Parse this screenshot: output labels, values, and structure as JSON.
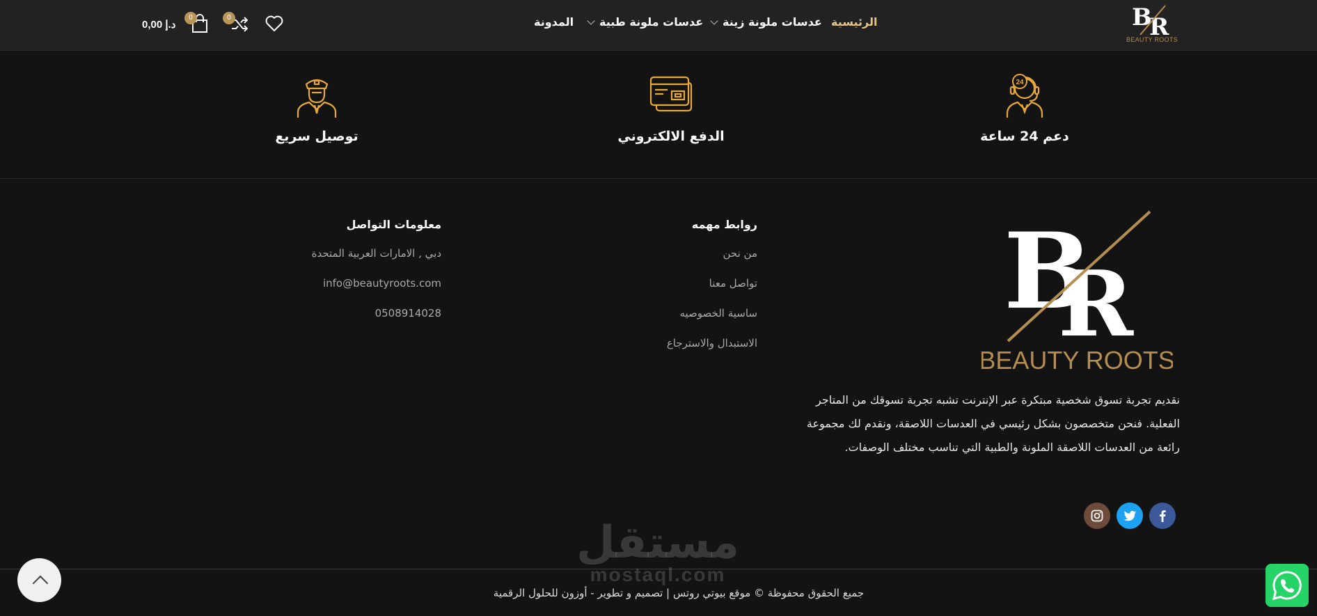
{
  "header": {
    "logo_text": "BEAUTY ROOTS",
    "nav": [
      {
        "label": "الرئيسية",
        "active": true
      },
      {
        "label": "عدسات ملونة زينة",
        "has_dropdown": true
      },
      {
        "label": "عدسات ملونة طبية",
        "has_dropdown": true
      },
      {
        "label": "المدونة"
      }
    ],
    "wishlist_icon": "heart-icon",
    "compare_icon": "shuffle-icon",
    "compare_count": "0",
    "cart_icon": "shopping-bag-icon",
    "cart_count": "0",
    "cart_total": "0,00 د.إ"
  },
  "features": [
    {
      "title": "دعم 24 ساعة",
      "icon": "support-24-icon"
    },
    {
      "title": "الدفع الالكتروني",
      "icon": "credit-card-icon"
    },
    {
      "title": "توصيل سريع",
      "icon": "delivery-person-icon"
    }
  ],
  "footer": {
    "logo_text": "BEAUTY ROOTS",
    "about": "نقديم تجربة تسوق شخصية مبتكرة عبر الإنترنت تشبه تجربة تسوقك من المتاجر الفعلية. فنحن متخصصون بشكل رئيسي في العدسات اللاصقة، ونقدم لك مجموعة رائعة من العدسات اللاصقة الملونة والطبية التي تناسب مختلف الوصفات.",
    "links_title": "روابط مهمه",
    "links": [
      "من نحن",
      "تواصل معنا",
      "ساسية الخصوصيه",
      "الاستبدال والاسترجاع"
    ],
    "contact_title": "معلومات التواصل",
    "contact": [
      "دبي , الامارات العربية المتحدة",
      "info@beautyroots.com",
      "0508914028"
    ],
    "social": [
      {
        "name": "facebook-icon",
        "color": "#3b5998"
      },
      {
        "name": "twitter-icon",
        "color": "#1da1f2"
      },
      {
        "name": "instagram-icon",
        "color": "#6e4a3b"
      }
    ],
    "copyright": "جميع الحقوق محفوظة © موقع بيوتي روتس | تصميم و تطوير - أوزون للحلول الرقمية"
  },
  "watermark": {
    "arabic": "مستقل",
    "latin": "mostaql.com"
  },
  "colors": {
    "accent": "#e7a93a",
    "gold": "#b48d4f",
    "background": "#131313",
    "header": "#222222"
  }
}
